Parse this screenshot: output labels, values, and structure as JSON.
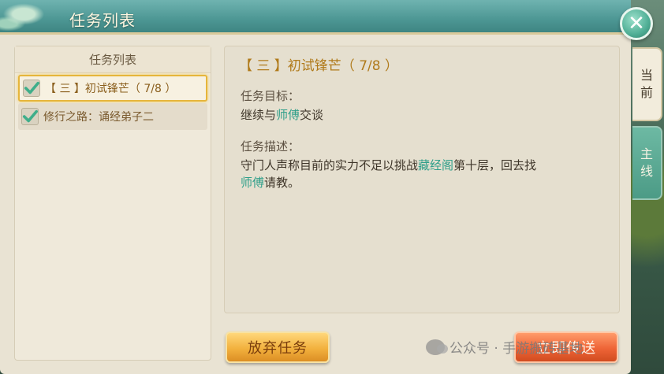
{
  "window": {
    "title": "任务列表",
    "close_glyph": "✕"
  },
  "quest_list": {
    "header": "任务列表",
    "items": [
      {
        "label": "【 三 】初试锋芒（ 7/8 ）",
        "checked": true,
        "selected": true
      },
      {
        "label": "修行之路：诵经弟子二",
        "checked": true,
        "selected": false
      }
    ]
  },
  "detail": {
    "title": "【 三 】初试锋芒（ 7/8 ）",
    "goal_label": "任务目标：",
    "goal_pre": "继续与",
    "goal_hl": "师傅",
    "goal_post": "交谈",
    "desc_label": "任务描述：",
    "desc_pre": "守门人声称目前的实力不足以挑战",
    "desc_hl1": "藏经阁",
    "desc_mid": "第十层，回去找",
    "desc_hl2": "师傅",
    "desc_post": "请教。"
  },
  "tabs": {
    "current_l1": "当",
    "current_l2": "前",
    "main_l1": "主",
    "main_l2": "线"
  },
  "buttons": {
    "abandon": "放弃任务",
    "teleport": "立即传送"
  },
  "watermark": {
    "text": "公众号 · 手游搬砖基地"
  },
  "colors": {
    "highlight": "#2f9f8a",
    "quest_title": "#b07a1a",
    "title_bar": "#4d9794",
    "checkmark": "#3fae8a"
  },
  "icons": {
    "close": "close-icon",
    "check": "checkmark-icon",
    "watermark": "wechat-icon"
  }
}
